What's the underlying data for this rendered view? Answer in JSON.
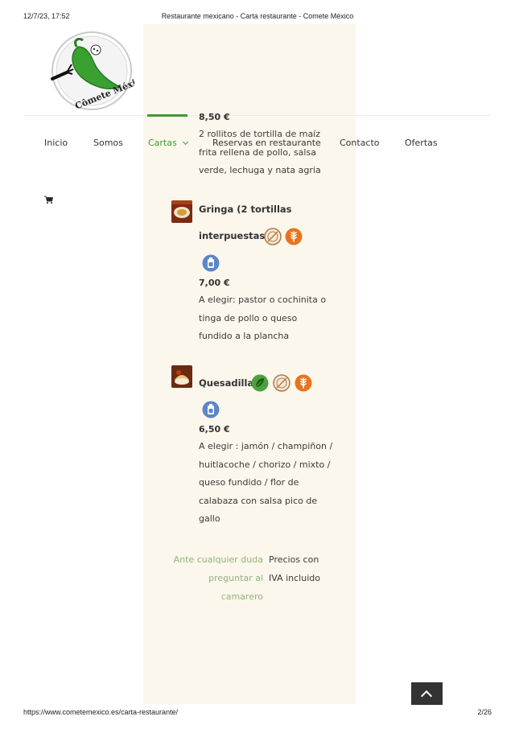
{
  "print_header": {
    "datetime": "12/7/23, 17:52",
    "title": "Restaurante mexicano - Carta restaurante - Comete México"
  },
  "print_footer": {
    "url": "https://www.cometemexico.es/carta-restaurante/",
    "page": "2/26"
  },
  "logo": {
    "text": "Cômete México!",
    "icon": "chili-pepper-plate-logo"
  },
  "nav": {
    "items": [
      {
        "label": "Inicio"
      },
      {
        "label": "Somos"
      },
      {
        "label": "Cartas",
        "active": true
      },
      {
        "label": "Reservas en restaurante"
      },
      {
        "label": "Contacto"
      },
      {
        "label": "Ofertas"
      }
    ],
    "active_color": "#3f9a34"
  },
  "cart": {
    "icon": "shopping-cart-icon"
  },
  "dishes": [
    {
      "price": "8,50 €",
      "description_lines": [
        "2 rollitos de tortilla de maíz",
        "frita rellena de pollo, salsa",
        "verde, lechuga y nata agria"
      ]
    },
    {
      "name_lines": [
        "Gringa (2 tortillas",
        "interpuestas)"
      ],
      "badges": [
        "gluten-free-icon",
        "wheat-icon",
        "lactose-icon"
      ],
      "price": "7,00 €",
      "description_lines": [
        "A elegir: pastor o cochinita o",
        "tinga de pollo o queso",
        "fundido a la plancha"
      ]
    },
    {
      "name_lines": [
        "Quesadilla"
      ],
      "badges": [
        "vegetarian-leaf-icon",
        "gluten-free-icon",
        "wheat-icon",
        "lactose-icon"
      ],
      "price": "6,50 €",
      "description_lines": [
        "A elegir : jamón / champiñon /",
        "huitlacoche / chorizo / mixto /",
        "queso fundido / flor de",
        "calabaza con salsa pico de",
        "gallo"
      ]
    }
  ],
  "notes": {
    "left_lines": [
      "Ante cualquier duda",
      "preguntar al",
      "camarero"
    ],
    "right_lines": [
      "Precios con",
      "IVA incluido"
    ]
  },
  "colors": {
    "accent_green": "#3f9a34",
    "note_green": "#8fb47c",
    "panel_cream": "#fbf7ec",
    "badge_orange": "#e8741e",
    "badge_blue": "#5b86c9"
  }
}
